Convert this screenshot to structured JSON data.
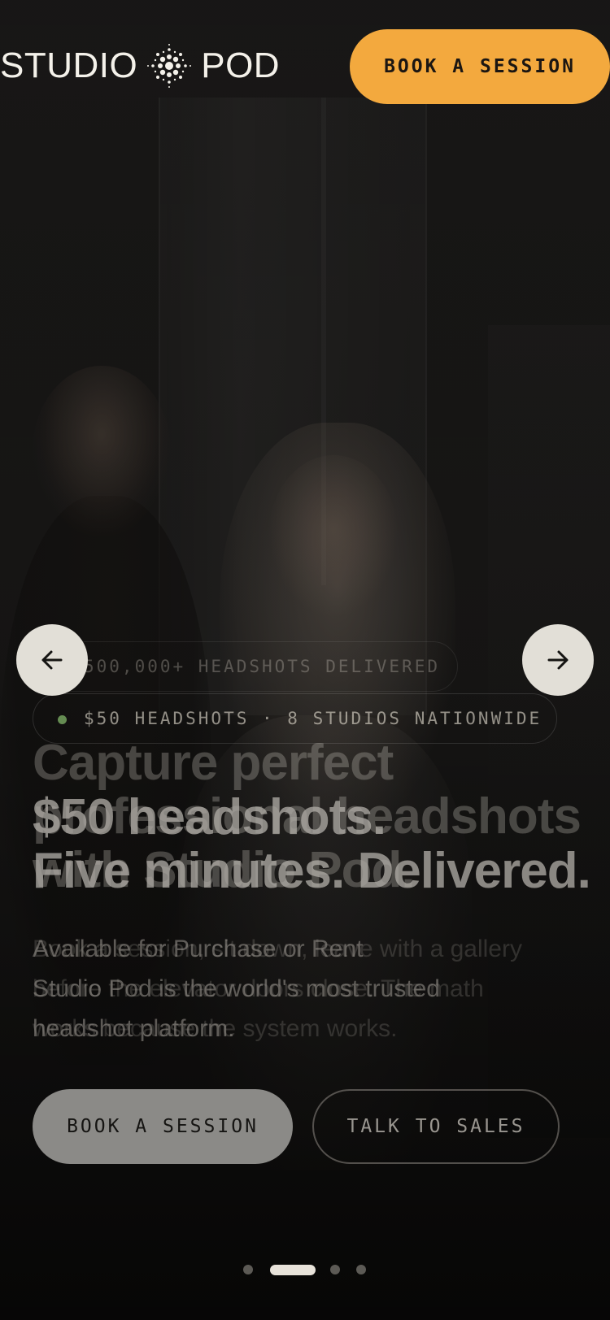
{
  "header": {
    "logo": {
      "left": "STUDIO",
      "right": "POD",
      "mark": "starburst-icon"
    },
    "cta_label": "BOOK A SESSION"
  },
  "slides": [
    {
      "badge": "500,000+ HEADSHOTS DELIVERED",
      "headline_line1": "Capture perfect",
      "headline_line2": "professional headshots",
      "headline_line3": "with Studio Pod.",
      "sub_line1": "Book a session, sit down, leave with a gallery",
      "sub_line2": "before the elevator doors close. The math",
      "sub_line3": "works because the system works."
    },
    {
      "badge": "$50 HEADSHOTS · 8 STUDIOS NATIONWIDE",
      "headline_line1": "$50 headshots.",
      "headline_line2": "Five minutes. Delivered.",
      "sub_line1": "Available for Purchase or Rent",
      "sub_line2": "Studio Pod is the world's most trusted",
      "sub_line3": "headshot platform."
    }
  ],
  "actions": {
    "primary_label": "BOOK A SESSION",
    "secondary_label": "TALK TO SALES"
  },
  "carousel": {
    "prev_icon": "arrow-left-icon",
    "next_icon": "arrow-right-icon",
    "total_slides": 4,
    "active_index": 1
  },
  "colors": {
    "accent": "#f3a93e",
    "background": "#141312",
    "status_dot": "#6f9a5a",
    "arrow_bg": "#e2dfd7"
  }
}
